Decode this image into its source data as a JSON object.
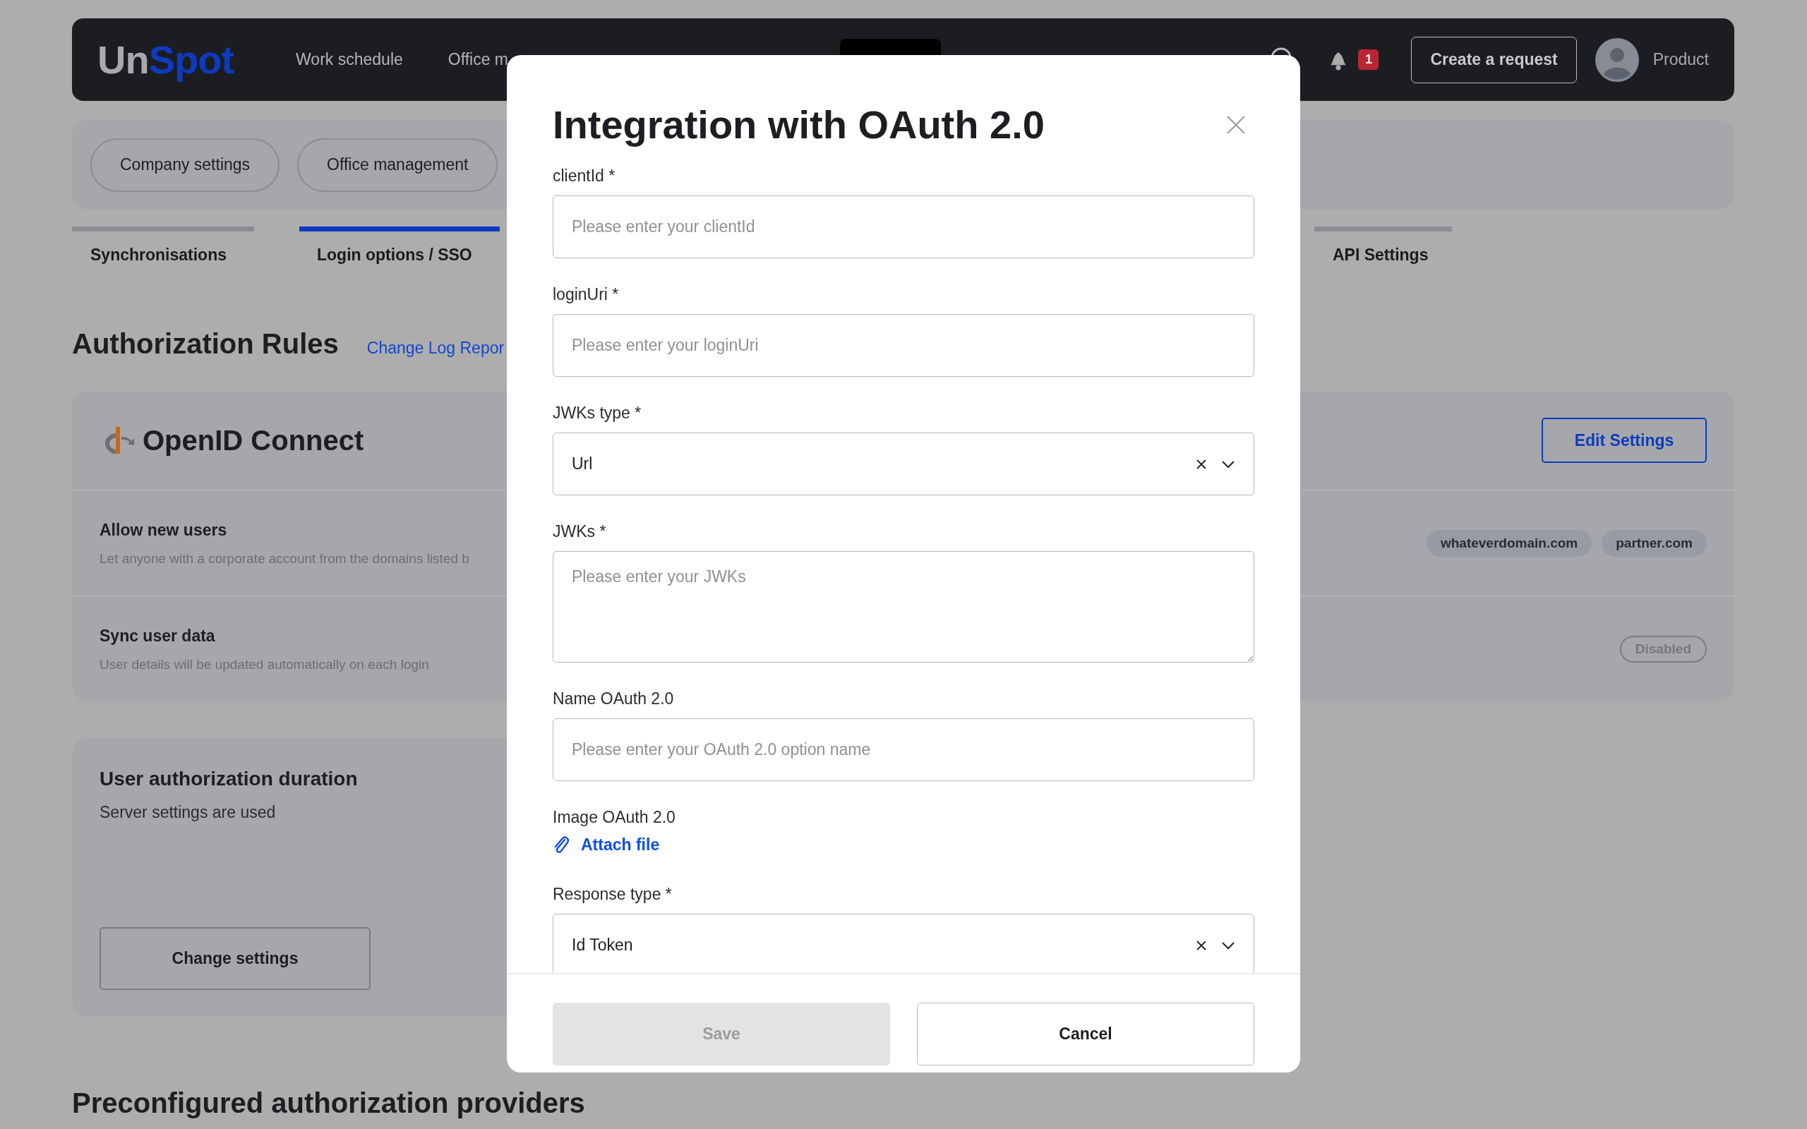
{
  "nav": {
    "logo_part_1": "Un",
    "logo_part_2": "Spot",
    "items": [
      {
        "label": "Work schedule"
      },
      {
        "label": "Office m"
      }
    ],
    "notification_count": "1",
    "create_button": "Create a request",
    "user_name": "Product"
  },
  "section_pills": [
    {
      "label": "Company settings"
    },
    {
      "label": "Office management"
    }
  ],
  "tabs": [
    {
      "label": "Synchronisations",
      "selected": false
    },
    {
      "label": "Login options / SSO",
      "selected": true
    },
    {
      "label": "API Settings",
      "selected": false
    }
  ],
  "section": {
    "title": "Authorization Rules",
    "link": "Change Log Repor"
  },
  "provider_card": {
    "title": "OpenID Connect",
    "button": "Edit Settings",
    "rows": [
      {
        "kind": "domains",
        "title": "Allow new users",
        "description": "Let anyone with a corporate account from the domains listed b",
        "domains": [
          "whateverdomain.com",
          "partner.com"
        ]
      },
      {
        "kind": "status",
        "title": "Sync user data",
        "description": "User details will be updated automatically on each login",
        "status": "Disabled"
      }
    ]
  },
  "duration_card": {
    "title": "User authorization duration",
    "description": "Server settings are used",
    "button": "Change settings"
  },
  "next_heading": "Preconfigured authorization providers",
  "modal": {
    "title": "Integration with OAuth 2.0",
    "fields": [
      {
        "kind": "input",
        "label": "clientId *",
        "placeholder": "Please enter your clientId"
      },
      {
        "kind": "input",
        "label": "loginUri *",
        "placeholder": "Please enter your loginUri"
      },
      {
        "kind": "select",
        "label": "JWKs type *",
        "value": "Url"
      },
      {
        "kind": "textarea",
        "label": "JWKs *",
        "placeholder": "Please enter your JWKs"
      },
      {
        "kind": "input",
        "label": "Name OAuth 2.0",
        "placeholder": "Please enter your OAuth 2.0 option name"
      },
      {
        "kind": "file",
        "label": "Image OAuth 2.0",
        "action": "Attach file"
      },
      {
        "kind": "select",
        "label": "Response type *",
        "value": "Id Token"
      }
    ],
    "buttons": [
      {
        "label": "Save",
        "disabled": true
      },
      {
        "label": "Cancel",
        "disabled": false
      }
    ]
  }
}
